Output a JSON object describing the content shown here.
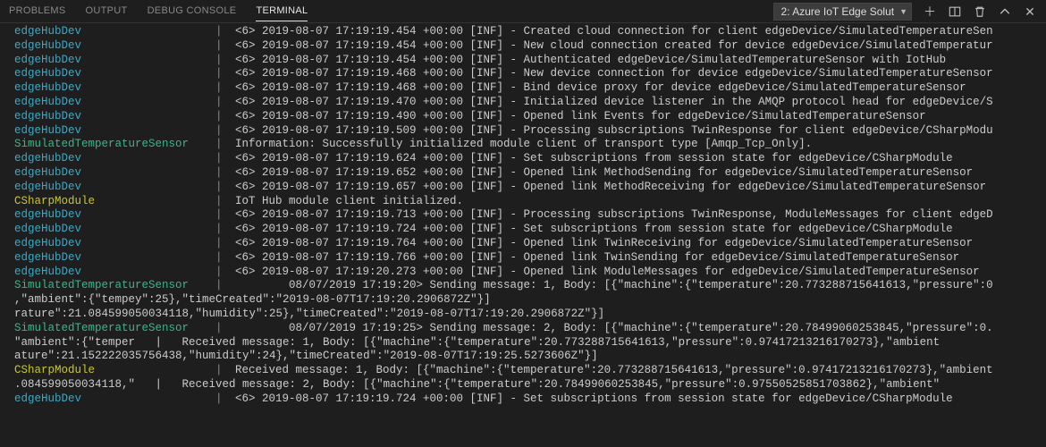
{
  "tabs": {
    "problems": "PROBLEMS",
    "output": "OUTPUT",
    "debug": "DEBUG CONSOLE",
    "terminal": "TERMINAL"
  },
  "terminal_select": "2: Azure IoT Edge Solut",
  "sources": {
    "edgeHubDev": "edgeHubDev",
    "simSensor": "SimulatedTemperatureSensor",
    "csharp": "CSharpModule"
  },
  "lines": [
    {
      "src": "edgeHubDev",
      "color": "cyan",
      "msg": "<6> 2019-08-07 17:19:19.454 +00:00 [INF] - Created cloud connection for client edgeDevice/SimulatedTemperatureSen"
    },
    {
      "src": "edgeHubDev",
      "color": "cyan",
      "msg": "<6> 2019-08-07 17:19:19.454 +00:00 [INF] - New cloud connection created for device edgeDevice/SimulatedTemperatur"
    },
    {
      "src": "edgeHubDev",
      "color": "cyan",
      "msg": "<6> 2019-08-07 17:19:19.454 +00:00 [INF] - Authenticated edgeDevice/SimulatedTemperatureSensor with IotHub"
    },
    {
      "src": "edgeHubDev",
      "color": "cyan",
      "msg": "<6> 2019-08-07 17:19:19.468 +00:00 [INF] - New device connection for device edgeDevice/SimulatedTemperatureSensor"
    },
    {
      "src": "edgeHubDev",
      "color": "cyan",
      "msg": "<6> 2019-08-07 17:19:19.468 +00:00 [INF] - Bind device proxy for device edgeDevice/SimulatedTemperatureSensor"
    },
    {
      "src": "edgeHubDev",
      "color": "cyan",
      "msg": "<6> 2019-08-07 17:19:19.470 +00:00 [INF] - Initialized device listener in the AMQP protocol head for edgeDevice/S"
    },
    {
      "src": "edgeHubDev",
      "color": "cyan",
      "msg": "<6> 2019-08-07 17:19:19.490 +00:00 [INF] - Opened link Events for edgeDevice/SimulatedTemperatureSensor"
    },
    {
      "src": "edgeHubDev",
      "color": "cyan",
      "msg": "<6> 2019-08-07 17:19:19.509 +00:00 [INF] - Processing subscriptions TwinResponse for client edgeDevice/CSharpModu"
    },
    {
      "src": "simSensor",
      "color": "green",
      "msg": "Information: Successfully initialized module client of transport type [Amqp_Tcp_Only]."
    },
    {
      "src": "edgeHubDev",
      "color": "cyan",
      "msg": "<6> 2019-08-07 17:19:19.624 +00:00 [INF] - Set subscriptions from session state for edgeDevice/CSharpModule"
    },
    {
      "src": "edgeHubDev",
      "color": "cyan",
      "msg": "<6> 2019-08-07 17:19:19.652 +00:00 [INF] - Opened link MethodSending for edgeDevice/SimulatedTemperatureSensor"
    },
    {
      "src": "edgeHubDev",
      "color": "cyan",
      "msg": "<6> 2019-08-07 17:19:19.657 +00:00 [INF] - Opened link MethodReceiving for edgeDevice/SimulatedTemperatureSensor"
    },
    {
      "src": "csharp",
      "color": "yellow",
      "msg": "IoT Hub module client initialized."
    },
    {
      "src": "edgeHubDev",
      "color": "cyan",
      "msg": "<6> 2019-08-07 17:19:19.713 +00:00 [INF] - Processing subscriptions TwinResponse, ModuleMessages for client edgeD"
    },
    {
      "src": "edgeHubDev",
      "color": "cyan",
      "msg": "<6> 2019-08-07 17:19:19.724 +00:00 [INF] - Set subscriptions from session state for edgeDevice/CSharpModule"
    },
    {
      "src": "edgeHubDev",
      "color": "cyan",
      "msg": "<6> 2019-08-07 17:19:19.764 +00:00 [INF] - Opened link TwinReceiving for edgeDevice/SimulatedTemperatureSensor"
    },
    {
      "src": "edgeHubDev",
      "color": "cyan",
      "msg": "<6> 2019-08-07 17:19:19.766 +00:00 [INF] - Opened link TwinSending for edgeDevice/SimulatedTemperatureSensor"
    },
    {
      "src": "edgeHubDev",
      "color": "cyan",
      "msg": "<6> 2019-08-07 17:19:20.273 +00:00 [INF] - Opened link ModuleMessages for edgeDevice/SimulatedTemperatureSensor"
    },
    {
      "src": "simSensor",
      "color": "green",
      "msg": "        08/07/2019 17:19:20> Sending message: 1, Body: [{\"machine\":{\"temperature\":20.773288715641613,\"pressure\":0"
    },
    {
      "wrap": ",\"ambient\":{\"tempey\":25},\"timeCreated\":\"2019-08-07T17:19:20.2906872Z\"}]"
    },
    {
      "wrap": "rature\":21.084599050034118,\"humidity\":25},\"timeCreated\":\"2019-08-07T17:19:20.2906872Z\"}]"
    },
    {
      "src": "simSensor",
      "color": "green",
      "msg": "        08/07/2019 17:19:25> Sending message: 2, Body: [{\"machine\":{\"temperature\":20.78499060253845,\"pressure\":0."
    },
    {
      "wrap": "\"ambient\":{\"temper   |   Received message: 1, Body: [{\"machine\":{\"temperature\":20.773288715641613,\"pressure\":0.97417213216170273},\"ambient"
    },
    {
      "wrap": "ature\":21.152222035756438,\"humidity\":24},\"timeCreated\":\"2019-08-07T17:19:25.5273606Z\"}]"
    },
    {
      "src": "csharp",
      "color": "yellow",
      "msg": "Received message: 1, Body: [{\"machine\":{\"temperature\":20.773288715641613,\"pressure\":0.97417213216170273},\"ambient"
    },
    {
      "wrap": ".084599050034118,\"   |   Received message: 2, Body: [{\"machine\":{\"temperature\":20.78499060253845,\"pressure\":0.97550525851703862},\"ambient\""
    },
    {
      "src": "edgeHubDev",
      "color": "cyan",
      "msg": "<6> 2019-08-07 17:19:19.724 +00:00 [INF] - Set subscriptions from session state for edgeDevice/CSharpModule"
    }
  ]
}
